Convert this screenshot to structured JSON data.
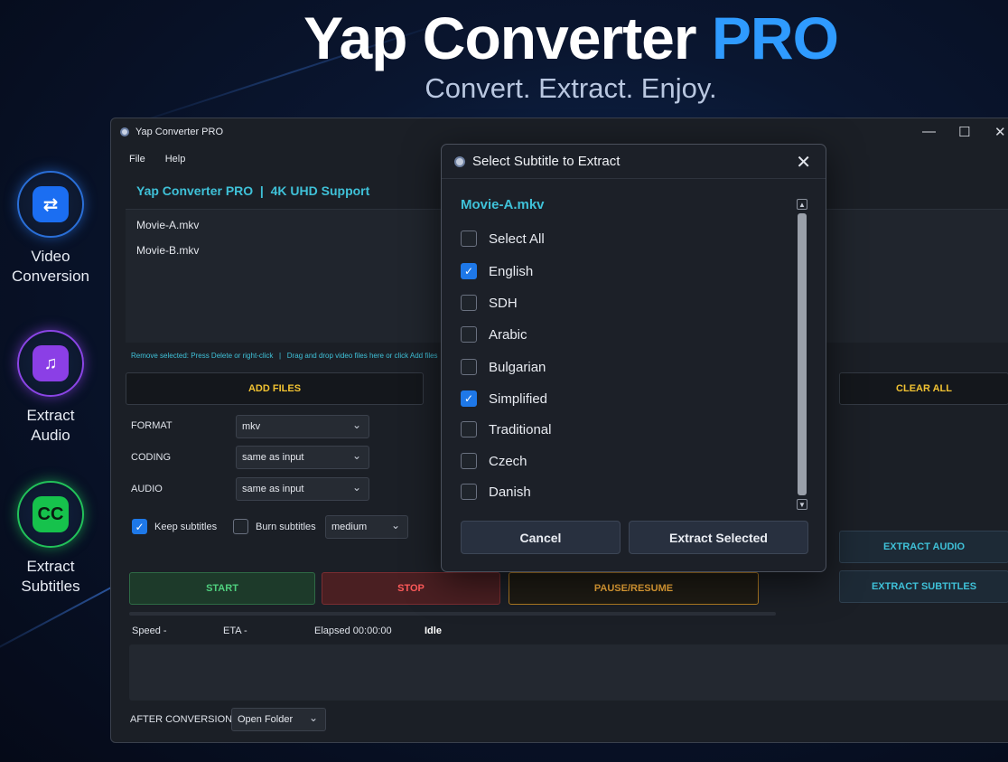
{
  "hero": {
    "title_main": "Yap Converter",
    "title_accent": "PRO",
    "subtitle": "Convert. Extract. Enjoy."
  },
  "features": [
    {
      "icon": "refresh-arrows-icon",
      "glyph": "⇄",
      "line1": "Video",
      "line2": "Conversion",
      "color": "#1b6ef2"
    },
    {
      "icon": "audio-file-icon",
      "glyph": "♫",
      "line1": "Extract",
      "line2": "Audio",
      "color": "#8b3fe6"
    },
    {
      "icon": "cc-icon",
      "glyph": "CC",
      "line1": "Extract",
      "line2": "Subtitles",
      "color": "#16c24c"
    }
  ],
  "window": {
    "title": "Yap Converter PRO",
    "menu": [
      "File",
      "Help"
    ],
    "brandline": "Yap Converter PRO  |  4K UHD Support",
    "files": [
      "Movie-A.mkv",
      "Movie-B.mkv"
    ],
    "hint": "Remove selected: Press Delete or right-click   |   Drag and drop video files here or click Add files",
    "add_files": "ADD FILES",
    "clear_all": "CLEAR ALL",
    "format_label": "FORMAT",
    "format_value": "mkv",
    "coding_label": "CODING",
    "coding_value": "same as input",
    "audio_label": "AUDIO",
    "audio_value": "same as input",
    "keep_subs": "Keep subtitles",
    "keep_subs_checked": true,
    "burn_subs": "Burn subtitles",
    "burn_subs_checked": false,
    "burn_quality": "medium",
    "start": "START",
    "stop": "STOP",
    "pause": "PAUSE/RESUME",
    "extract_audio": "EXTRACT AUDIO",
    "extract_subtitles": "EXTRACT SUBTITLES",
    "speed": "Speed -",
    "eta": "ETA -",
    "elapsed": "Elapsed 00:00:00",
    "status": "Idle",
    "after_label": "AFTER CONVERSION",
    "after_value": "Open Folder"
  },
  "modal": {
    "title": "Select Subtitle to Extract",
    "file": "Movie-A.mkv",
    "items": [
      {
        "label": "Select All",
        "checked": false
      },
      {
        "label": "English",
        "checked": true
      },
      {
        "label": "SDH",
        "checked": false
      },
      {
        "label": "Arabic",
        "checked": false
      },
      {
        "label": "Bulgarian",
        "checked": false
      },
      {
        "label": "Simplified",
        "checked": true
      },
      {
        "label": "Traditional",
        "checked": false
      },
      {
        "label": "Czech",
        "checked": false
      },
      {
        "label": "Danish",
        "checked": false
      }
    ],
    "cancel": "Cancel",
    "extract": "Extract Selected"
  }
}
